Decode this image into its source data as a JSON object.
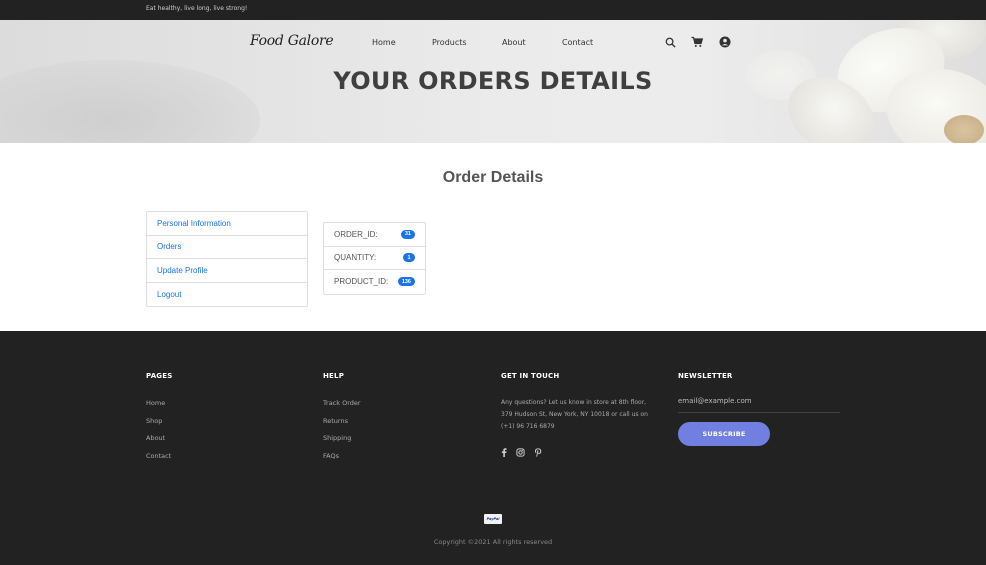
{
  "topbar": {
    "tagline": "Eat healthy, live long, live strong!"
  },
  "header": {
    "logo": "Food Galore",
    "nav": [
      "Home",
      "Products",
      "About",
      "Contact"
    ],
    "icons": [
      "search-icon",
      "cart-icon",
      "user-account-icon"
    ]
  },
  "hero": {
    "title": "YOUR ORDERS DETAILS"
  },
  "main": {
    "title": "Order Details",
    "sidebar": [
      "Personal Information",
      "Orders",
      "Update Profile",
      "Logout"
    ],
    "details": [
      {
        "label": "ORDER_ID:",
        "value": "31"
      },
      {
        "label": "QUANTITY:",
        "value": "1"
      },
      {
        "label": "PRODUCT_ID:",
        "value": "136"
      }
    ]
  },
  "footer": {
    "pages": {
      "title": "PAGES",
      "links": [
        "Home",
        "Shop",
        "About",
        "Contact"
      ]
    },
    "help": {
      "title": "HELP",
      "links": [
        "Track Order",
        "Returns",
        "Shipping",
        "FAQs"
      ]
    },
    "contact": {
      "title": "GET IN TOUCH",
      "text": "Any questions? Let us know in store at 8th floor, 379 Hudson St, New York, NY 10018 or call us on (+1) 96 716 6879",
      "social_icons": [
        "facebook-icon",
        "instagram-icon",
        "pinterest-icon"
      ]
    },
    "newsletter": {
      "title": "NEWSLETTER",
      "placeholder": "email@example.com",
      "button": "SUBSCRIBE"
    },
    "payment": "PayPal",
    "copyright": "Copyright ©2021 All rights reserved"
  }
}
